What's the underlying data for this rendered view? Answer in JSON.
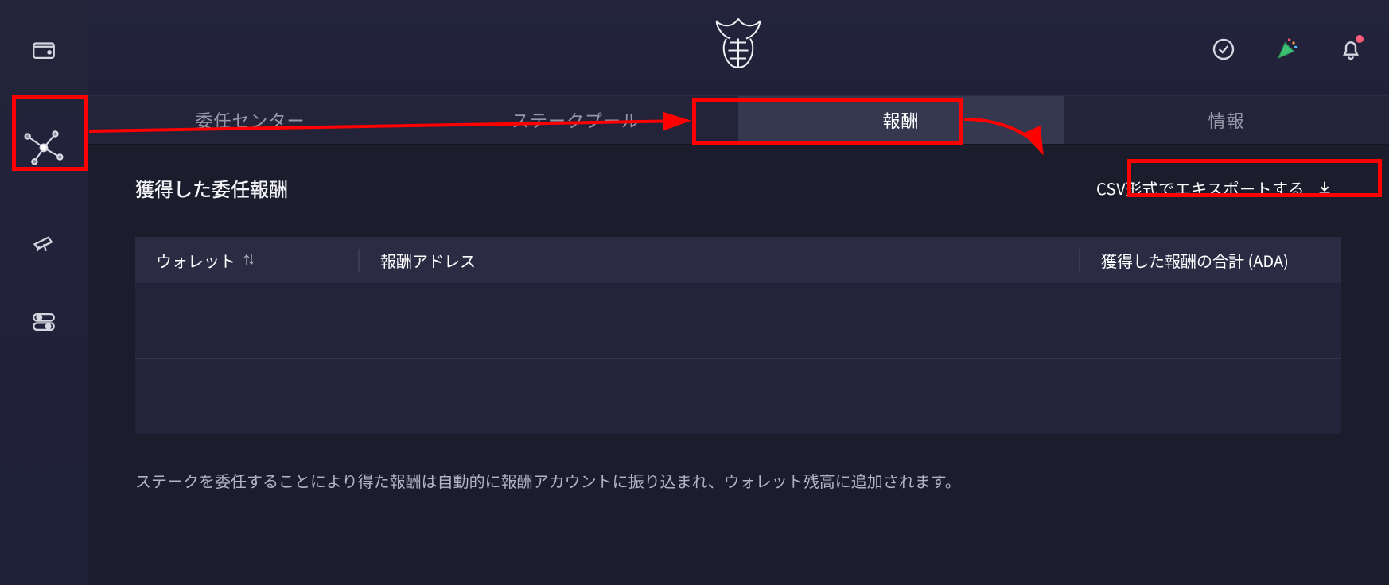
{
  "colors": {
    "accent_highlight": "#ff0000",
    "bg": "#1e1f2e",
    "panel": "#23243a",
    "tab_active_bg": "#363850",
    "text": "#e8e8ee",
    "text_muted": "#9797a8"
  },
  "sidebar": {
    "items": [
      {
        "name": "wallet-icon"
      },
      {
        "name": "network-staking-icon"
      },
      {
        "name": "telescope-icon"
      },
      {
        "name": "settings-toggles-icon"
      }
    ]
  },
  "header": {
    "logo_name": "daedalus-bull-logo",
    "actions": [
      {
        "name": "sync-icon"
      },
      {
        "name": "confetti-icon"
      },
      {
        "name": "bell-icon",
        "has_badge": true
      }
    ]
  },
  "tabs": [
    {
      "id": "delegation-center",
      "label": "委任センター",
      "active": false
    },
    {
      "id": "stake-pools",
      "label": "ステークプール",
      "active": false
    },
    {
      "id": "rewards",
      "label": "報酬",
      "active": true
    },
    {
      "id": "info",
      "label": "情報",
      "active": false
    }
  ],
  "page": {
    "title": "獲得した委任報酬",
    "export_label": "CSV形式でエキスポートする",
    "footnote": "ステークを委任することにより得た報酬は自動的に報酬アカウントに振り込まれ、ウォレット残高に追加されます。"
  },
  "table": {
    "columns": {
      "wallet": "ウォレット",
      "reward_address": "報酬アドレス",
      "total_rewards": "獲得した報酬の合計 (ADA)"
    },
    "sort_indicator_on": "wallet",
    "rows": [
      {
        "wallet": "",
        "reward_address": "",
        "total_rewards": ""
      },
      {
        "wallet": "",
        "reward_address": "",
        "total_rewards": ""
      }
    ]
  }
}
